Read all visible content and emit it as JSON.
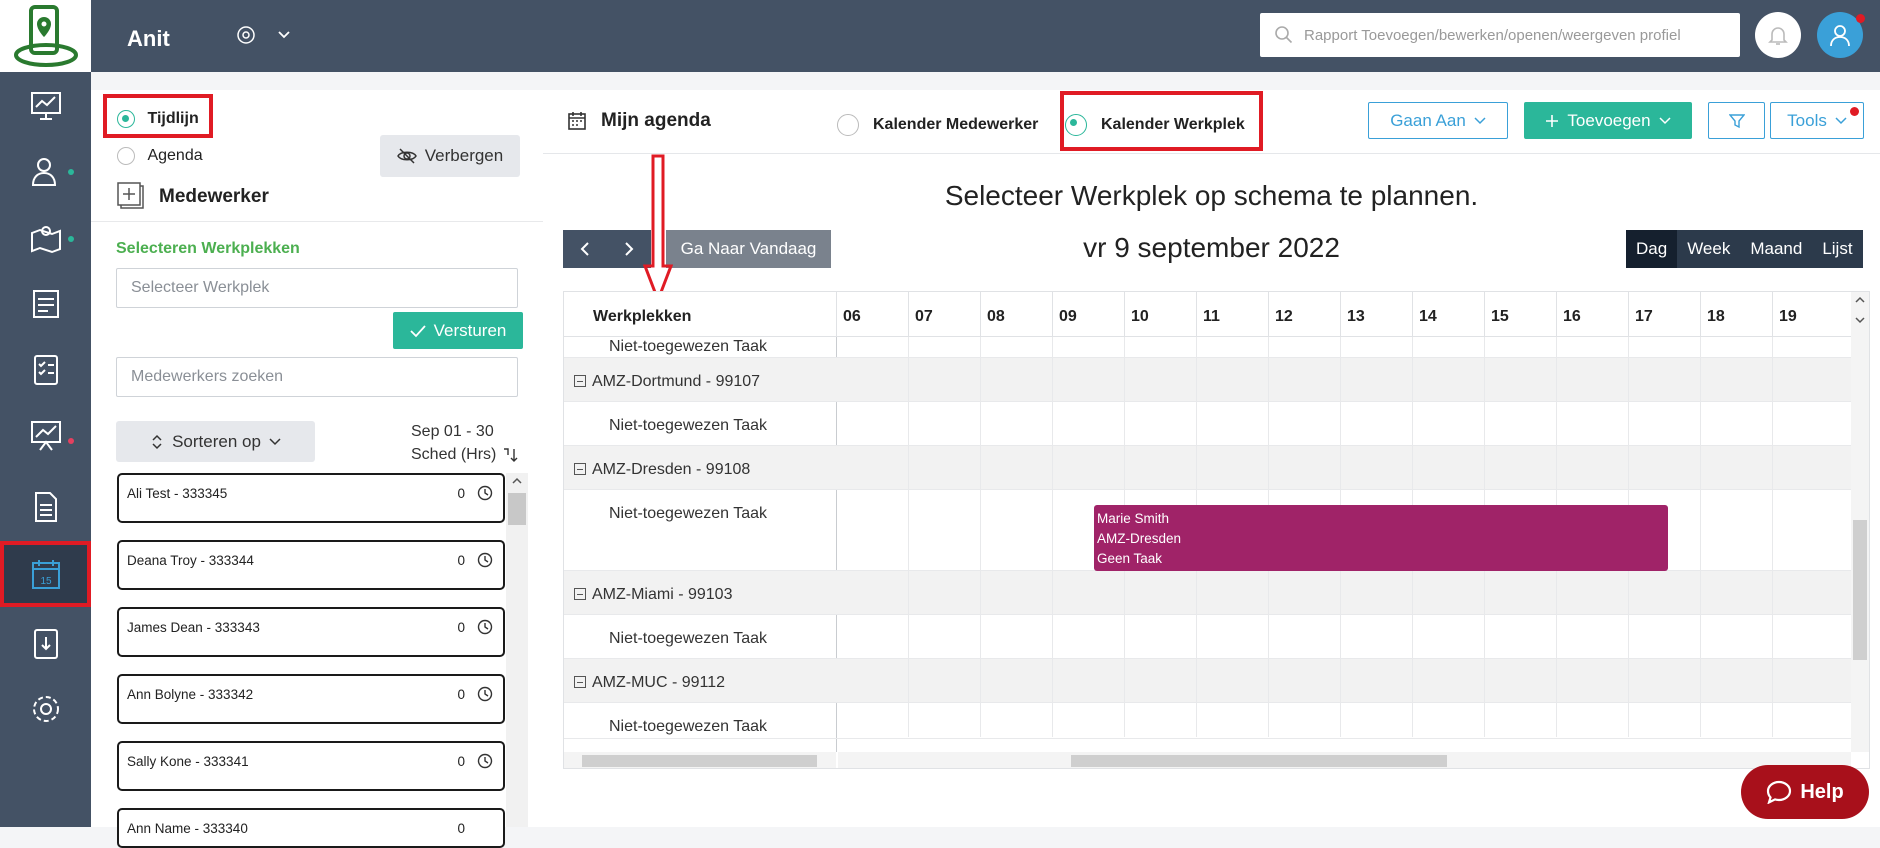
{
  "topbar": {
    "company": "Anit",
    "search_placeholder": "Rapport Toevoegen/bewerken/openen/weergeven profiel"
  },
  "rail": {
    "icons": [
      "dashboard-icon",
      "users-icon",
      "map-pin-icon",
      "tasks-icon",
      "checklist-icon",
      "reports-icon",
      "document-icon",
      "calendar-icon",
      "clipboard-icon",
      "settings-icon"
    ],
    "active": "calendar-icon",
    "calendar_day": "15"
  },
  "side": {
    "view_timeline": "Tijdlijn",
    "view_agenda": "Agenda",
    "hide_label": "Verbergen",
    "employee_heading": "Medewerker",
    "select_workplaces_label": "Selecteren Werkplekken",
    "select_workplace_placeholder": "Selecteer Werkplek",
    "send_label": "Versturen",
    "search_employees_placeholder": "Medewerkers zoeken",
    "sort_label": "Sorteren op",
    "date_range": "Sep 01 - 30",
    "sched_label": "Sched (Hrs)",
    "employees": [
      {
        "name": "Ali Test - 333345",
        "hours": "0"
      },
      {
        "name": "Deana Troy - 333344",
        "hours": "0"
      },
      {
        "name": "James Dean - 333343",
        "hours": "0"
      },
      {
        "name": "Ann Bolyne - 333342",
        "hours": "0"
      },
      {
        "name": "Sally Kone - 333341",
        "hours": "0"
      },
      {
        "name": "Ann Name - 333340",
        "hours": "0"
      }
    ]
  },
  "main": {
    "title": "Mijn agenda",
    "radio_employee": "Kalender Medewerker",
    "radio_workplace": "Kalender Werkplek",
    "goto_label": "Gaan Aan",
    "add_label": "Toevoegen",
    "tools_label": "Tools",
    "notice": "Selecteer Werkplek op schema te plannen.",
    "today_label": "Ga Naar Vandaag",
    "date_label": "vr 9 september 2022",
    "views": [
      "Dag",
      "Week",
      "Maand",
      "Lijst"
    ],
    "active_view": "Dag",
    "column_header": "Werkplekken",
    "hours": [
      "06",
      "07",
      "08",
      "09",
      "10",
      "11",
      "12",
      "13",
      "14",
      "15",
      "16",
      "17",
      "18",
      "19"
    ],
    "rows": [
      {
        "type": "task",
        "label": "Niet-toegewezen Taak"
      },
      {
        "type": "group",
        "label": "AMZ-Dortmund - 99107"
      },
      {
        "type": "task",
        "label": "Niet-toegewezen Taak"
      },
      {
        "type": "group",
        "label": "AMZ-Dresden - 99108"
      },
      {
        "type": "task",
        "label": "Niet-toegewezen Taak"
      },
      {
        "type": "group",
        "label": "AMZ-Miami - 99103"
      },
      {
        "type": "task",
        "label": "Niet-toegewezen Taak"
      },
      {
        "type": "group",
        "label": "AMZ-MUC - 99112"
      },
      {
        "type": "task",
        "label": "Niet-toegewezen Taak"
      }
    ],
    "event": {
      "line1": "Marie Smith",
      "line2": "AMZ-Dresden",
      "line3": "Geen Taak"
    }
  },
  "help_label": "Help",
  "colors": {
    "rail": "#445265",
    "accent": "#2bb79a",
    "event": "#a02368",
    "highlight": "#e01b24"
  }
}
